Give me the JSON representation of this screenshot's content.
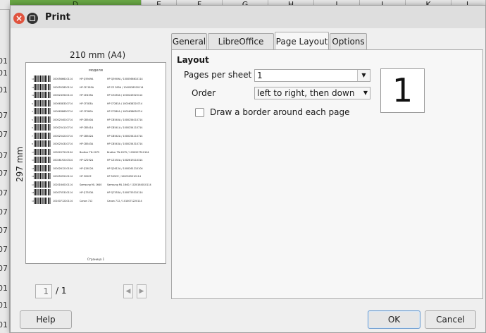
{
  "spreadsheet": {
    "columns": [
      {
        "label": "D",
        "selected": true
      },
      {
        "label": "E",
        "selected": false
      },
      {
        "label": "F",
        "selected": false
      },
      {
        "label": "G",
        "selected": false
      },
      {
        "label": "H",
        "selected": false
      },
      {
        "label": "I",
        "selected": false
      },
      {
        "label": "J",
        "selected": false
      },
      {
        "label": "K",
        "selected": false
      },
      {
        "label": "L",
        "selected": false
      }
    ],
    "row_fragments": [
      "01",
      "01",
      "01",
      "07",
      "07",
      "07",
      "07",
      "07",
      "07",
      "07",
      "07",
      "07",
      "01",
      "01",
      "01"
    ]
  },
  "dialog": {
    "title": "Print",
    "close_icon": "close-icon",
    "maximize_icon": "maximize-icon"
  },
  "preview": {
    "paper_width": "210 mm (A4)",
    "paper_height": "297 mm",
    "header": "модели",
    "footer": "Страница 1",
    "rows": [
      {
        "num": "10",
        "code": "1000566610114",
        "model": "HP Q5949A",
        "desc": "HP Q5949A / 1000566610114"
      },
      {
        "num": "11",
        "code": "1000552820114",
        "model": "HP CE 285A",
        "desc": "HP CE 285A / 1000528520114"
      },
      {
        "num": "12",
        "code": "1000243520114",
        "model": "HP CE435A",
        "desc": "HP CE435A / 1000243520114"
      },
      {
        "num": "9",
        "code": "1000638320714",
        "model": "HP CF283A",
        "desc": "HP CF283A / 1000638320714"
      },
      {
        "num": "3",
        "code": "1000638630714",
        "model": "HP CF280A",
        "desc": "HP CF280A / 1000638630714"
      },
      {
        "num": "5",
        "code": "1000254010714",
        "model": "HP CB540A",
        "desc": "HP CB540A / 1000254010714"
      },
      {
        "num": "6",
        "code": "1000254110714",
        "model": "HP CB541A",
        "desc": "HP CB541A / 1000254110714"
      },
      {
        "num": "7",
        "code": "1000254210714",
        "model": "HP CB542A",
        "desc": "HP CB542A / 1000254210714"
      },
      {
        "num": "8",
        "code": "1000254310714",
        "model": "HP CB543A",
        "desc": "HP CB543A / 1000254310714"
      },
      {
        "num": "13",
        "code": "1090207510104",
        "model": "Brother TN-2075",
        "desc": "Brother TN-2075 / 1090207510104"
      },
      {
        "num": "14",
        "code": "1002619210314",
        "model": "HP CZ192A",
        "desc": "HP CZ192A / 1002619210314"
      },
      {
        "num": "15",
        "code": "1000261210104",
        "model": "HP Q2612A",
        "desc": "HP Q2612A / 1000261210104"
      },
      {
        "num": "16",
        "code": "1000505510114",
        "model": "HP 505CE",
        "desc": "HP 505CE / 1000505510114"
      },
      {
        "num": "17",
        "code": "1020164010114",
        "model": "Samsung ML 1640",
        "desc": "Samsung ML 1640 / 1020164010114"
      },
      {
        "num": "18",
        "code": "1000755310114",
        "model": "HP Q7553A",
        "desc": "HP Q7553A / 1000755310114"
      },
      {
        "num": "19",
        "code": "1010071220114",
        "model": "Canon 712",
        "desc": "Canon 712 / 1010071220114"
      }
    ]
  },
  "navigation": {
    "current_page": "1",
    "total": "/ 1",
    "prev_icon": "chevron-left-icon",
    "next_icon": "chevron-right-icon"
  },
  "tabs": [
    {
      "label": "General",
      "active": false
    },
    {
      "label": "LibreOffice Calc",
      "active": false
    },
    {
      "label": "Page Layout",
      "active": true
    },
    {
      "label": "Options",
      "active": false
    }
  ],
  "layout": {
    "heading": "Layout",
    "pages_per_sheet_label": "Pages per sheet",
    "pages_per_sheet_value": "1",
    "order_label": "Order",
    "order_value": "left to right, then down",
    "border_label": "Draw a border around each page",
    "border_checked": false,
    "preview_number": "1"
  },
  "buttons": {
    "help": "Help",
    "ok": "OK",
    "cancel": "Cancel"
  }
}
